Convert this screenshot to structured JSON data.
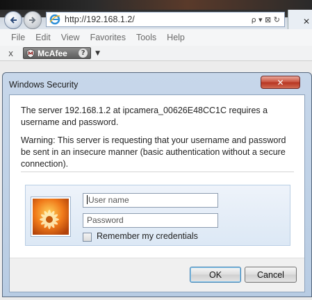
{
  "browser": {
    "address": "http://192.168.1.2/",
    "address_tools": "ρ ▾ ⊠ ↻",
    "tab_close": "✕",
    "menu": [
      "File",
      "Edit",
      "View",
      "Favorites",
      "Tools",
      "Help"
    ],
    "toolbar": {
      "close_glyph": "x",
      "mcafee_label": "McAfee",
      "mcafee_help": "?",
      "dropdown_glyph": "▼"
    }
  },
  "dialog": {
    "title": "Windows Security",
    "close_glyph": "✕",
    "message": "The server 192.168.1.2 at ipcamera_00626E48CC1C requires a username and password.",
    "warning": "Warning: This server is requesting that your username and password be sent in an insecure manner (basic authentication without a secure connection).",
    "username_placeholder": "User name",
    "password_placeholder": "Password",
    "remember_label": "Remember my credentials",
    "remember_checked": false,
    "ok_label": "OK",
    "cancel_label": "Cancel"
  },
  "colors": {
    "dialog_frame": "#b8cce3",
    "close_button": "#c8503c",
    "credential_panel": "#dce8f5"
  },
  "icons": [
    "back-arrow-icon",
    "forward-arrow-icon",
    "ie-logo-icon",
    "mcafee-shield-icon",
    "user-avatar-flower-icon"
  ]
}
